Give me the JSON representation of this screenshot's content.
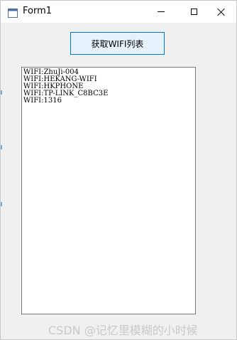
{
  "window": {
    "title": "Form1",
    "controls": {
      "minimize_icon": "minimize-icon",
      "maximize_icon": "maximize-icon",
      "close_icon": "close-icon"
    }
  },
  "main": {
    "get_wifi_button_label": "获取WIFI列表",
    "wifi_list": [
      "WIFI:ZhuJi-004",
      "WIFI:HEKANG-WIFI",
      "WIFI:HKPHONE",
      "WIFI:TP-LINK_C8BC3E",
      "WIFI:1316"
    ]
  },
  "watermark": "CSDN @记忆里模糊的小时候",
  "colors": {
    "button_border": "#0078d7",
    "button_bg": "#e5f1fb",
    "window_bg": "#f0f0f0"
  }
}
